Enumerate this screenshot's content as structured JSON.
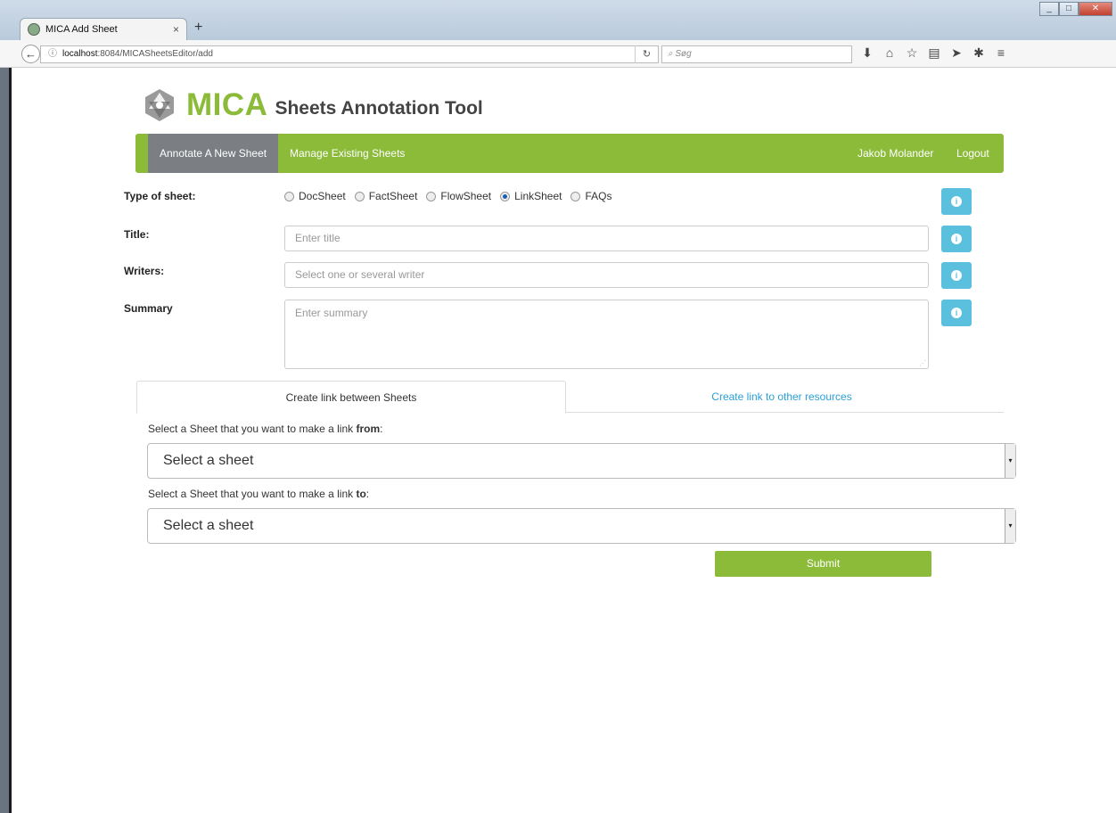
{
  "browser": {
    "tab_title": "MICA Add Sheet",
    "new_tab": "+",
    "close_tab": "×",
    "url_host": "localhost",
    "url_rest": ":8084/MICASheetsEditor/add",
    "search_placeholder": "Søg",
    "toolbar_icons": [
      "download-icon",
      "home-icon",
      "bookmark-star-icon",
      "reading-list-icon",
      "send-icon",
      "extension-icon",
      "menu-icon"
    ]
  },
  "header": {
    "brand": "MICA",
    "subtitle": "Sheets Annotation Tool"
  },
  "nav": {
    "annotate": "Annotate A New Sheet",
    "manage": "Manage Existing Sheets",
    "user": "Jakob Molander",
    "logout": "Logout"
  },
  "form": {
    "type_label": "Type of sheet:",
    "types": [
      "DocSheet",
      "FactSheet",
      "FlowSheet",
      "LinkSheet",
      "FAQs"
    ],
    "selected_type": "LinkSheet",
    "title_label": "Title:",
    "title_placeholder": "Enter title",
    "writers_label": "Writers:",
    "writers_placeholder": "Select one or several writer",
    "summary_label": "Summary",
    "summary_placeholder": "Enter summary"
  },
  "tabs": {
    "between": "Create link between Sheets",
    "other": "Create link to other resources"
  },
  "link": {
    "from_prefix": "Select a Sheet that you want to make a link ",
    "from_bold": "from",
    "to_prefix": "Select a Sheet that you want to make a link ",
    "to_bold": "to",
    "colon": ":",
    "select_placeholder": "Select a sheet"
  },
  "submit": "Submit",
  "colors": {
    "accent": "#8cbb3a",
    "info": "#5bc0de",
    "nav_active": "#7b7f84",
    "link": "#2a9fd6"
  }
}
